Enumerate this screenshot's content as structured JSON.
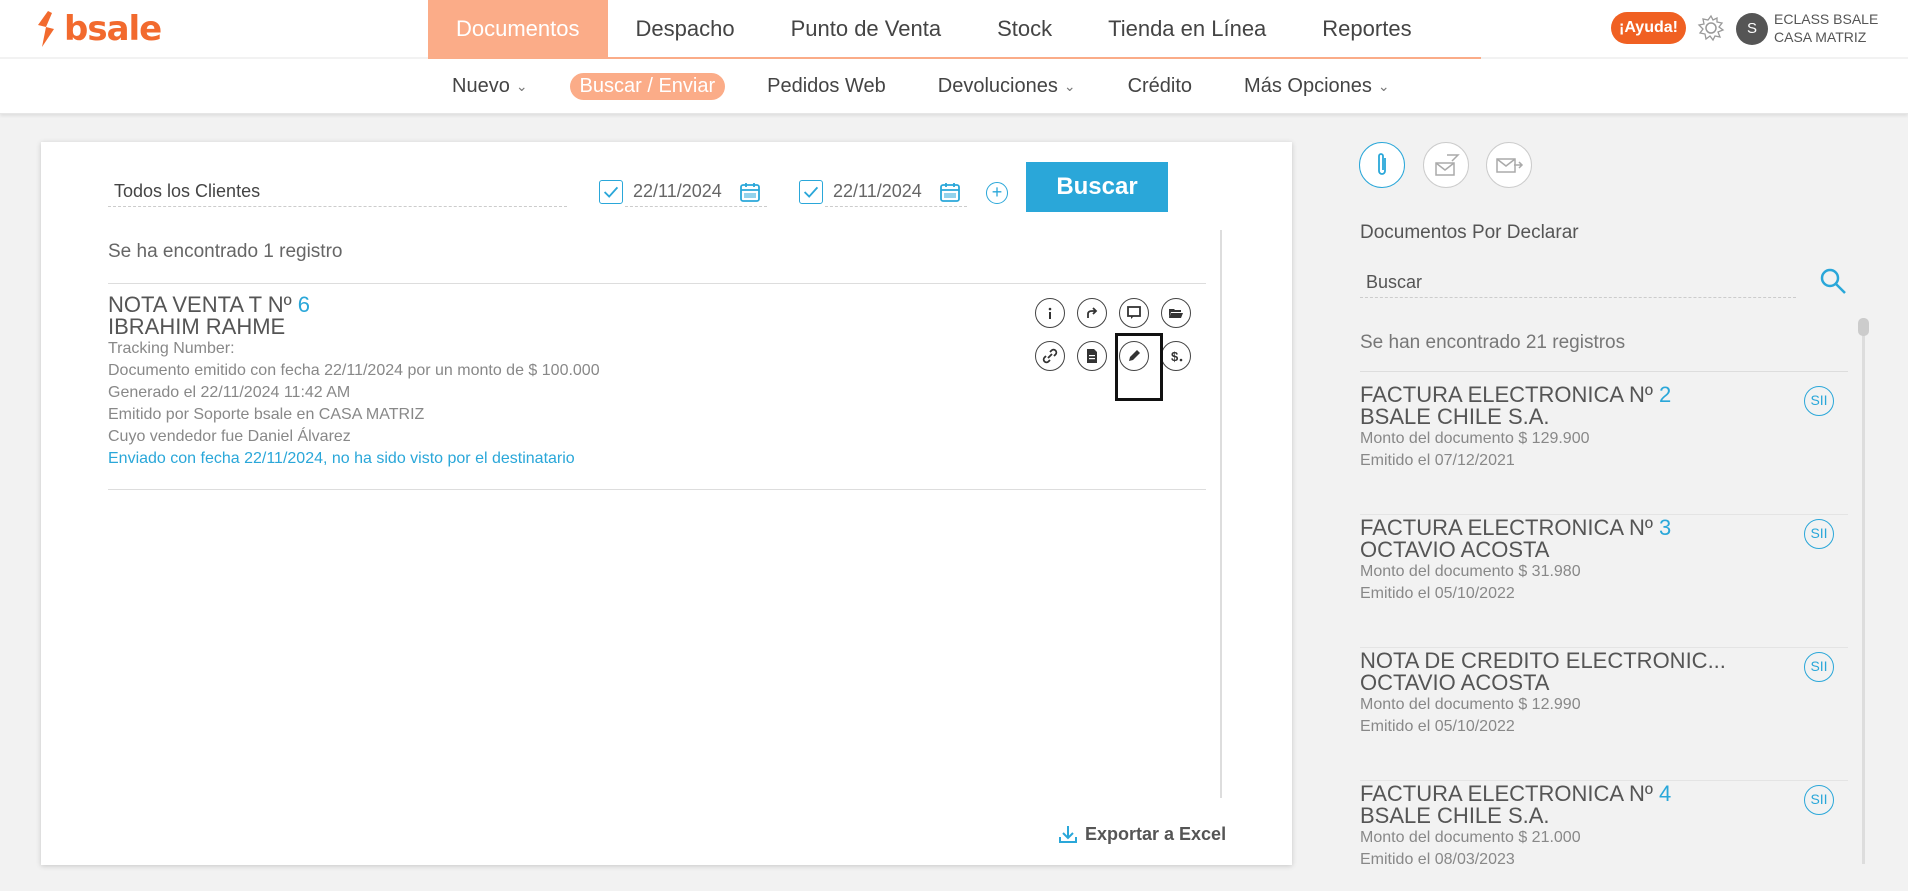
{
  "brand": {
    "name": "bsale",
    "color": "#f26a2e"
  },
  "main_nav": [
    "Documentos",
    "Despacho",
    "Punto de Venta",
    "Stock",
    "Tienda en Línea",
    "Reportes"
  ],
  "help_label": "¡Ayuda!",
  "user": {
    "initial": "S",
    "line1": "ECLASS BSALE",
    "line2": "CASA MATRIZ"
  },
  "sub_nav": {
    "nuevo": "Nuevo",
    "buscar": "Buscar / Enviar",
    "pedidos": "Pedidos Web",
    "devoluciones": "Devoluciones",
    "credito": "Crédito",
    "mas": "Más Opciones"
  },
  "filters": {
    "client": "Todos los Clientes",
    "date_from": "22/11/2024",
    "date_to": "22/11/2024",
    "search_button": "Buscar"
  },
  "results": {
    "count_text": "Se ha encontrado 1 registro",
    "document": {
      "title": "NOTA VENTA T Nº",
      "number": "6",
      "client": "IBRAHIM RAHME",
      "tracking": "Tracking Number:",
      "emitted": "Documento emitido con fecha 22/11/2024 por un monto de $ 100.000",
      "generated": "Generado el 22/11/2024 11:42 AM",
      "issued_by": "Emitido por Soporte bsale en CASA MATRIZ",
      "seller": "Cuyo vendedor fue Daniel Álvarez",
      "sent": "Enviado con fecha 22/11/2024, no ha sido visto por el destinatario"
    }
  },
  "export_label": "Exportar a Excel",
  "right_panel": {
    "title": "Documentos Por Declarar",
    "search_placeholder": "Buscar",
    "count_text": "Se han encontrado 21 registros",
    "items": [
      {
        "title": "FACTURA ELECTRONICA Nº",
        "number": "2",
        "client": "BSALE CHILE S.A.",
        "amount": "Monto del documento $ 129.900",
        "date": "Emitido el 07/12/2021",
        "badge": "SII"
      },
      {
        "title": "FACTURA ELECTRONICA Nº",
        "number": "3",
        "client": "OCTAVIO ACOSTA",
        "amount": "Monto del documento $ 31.980",
        "date": "Emitido el 05/10/2022",
        "badge": "SII"
      },
      {
        "title": "NOTA DE CREDITO ELECTRONIC...",
        "number": "",
        "client": "OCTAVIO ACOSTA",
        "amount": "Monto del documento $ 12.990",
        "date": "Emitido el 05/10/2022",
        "badge": "SII"
      },
      {
        "title": "FACTURA ELECTRONICA Nº",
        "number": "4",
        "client": "BSALE CHILE S.A.",
        "amount": "Monto del documento $ 21.000",
        "date": "Emitido el 08/03/2023",
        "badge": "SII"
      }
    ]
  },
  "colors": {
    "accent": "#2aa7d9",
    "nav_active": "#fbac88",
    "help": "#f06022"
  }
}
